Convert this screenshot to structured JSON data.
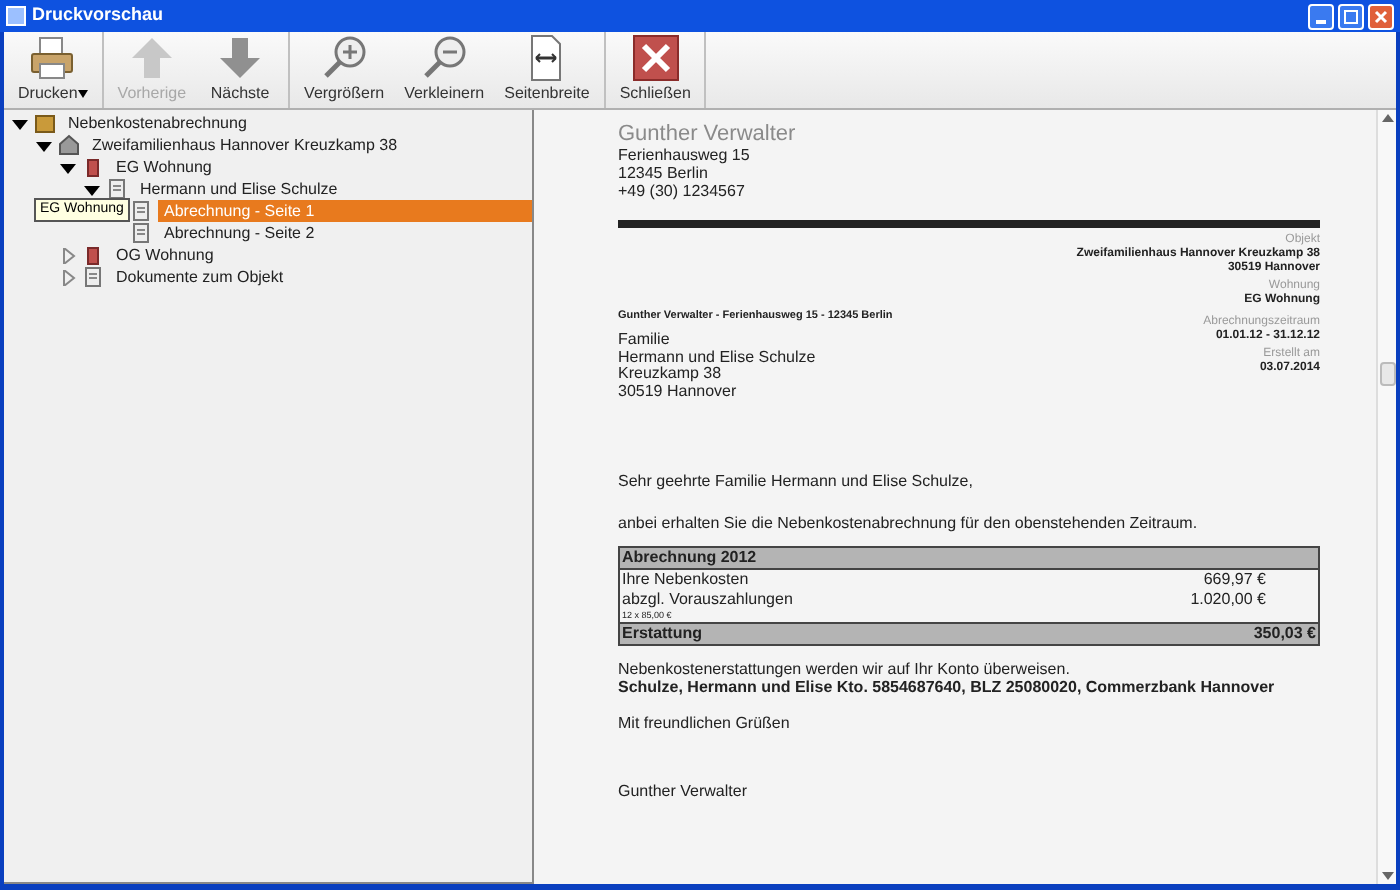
{
  "window": {
    "title": "Druckvorschau"
  },
  "toolbar": [
    [
      {
        "kind": "print",
        "label": "Drucken",
        "dropdown": true,
        "disabled": false
      }
    ],
    [
      {
        "kind": "prev",
        "label": "Vorherige",
        "dropdown": false,
        "disabled": true
      },
      {
        "kind": "next",
        "label": "Nächste",
        "dropdown": false,
        "disabled": false
      }
    ],
    [
      {
        "kind": "zoom_in",
        "label": "Vergrößern",
        "dropdown": false,
        "disabled": false
      },
      {
        "kind": "zoom_out",
        "label": "Verkleinern",
        "dropdown": false,
        "disabled": false
      },
      {
        "kind": "page_width",
        "label": "Seitenbreite",
        "dropdown": false,
        "disabled": false
      }
    ],
    [
      {
        "kind": "close",
        "label": "Schließen",
        "dropdown": false,
        "disabled": false
      }
    ]
  ],
  "tree": [
    {
      "kind": "root",
      "label": "Nebenkostenabrechnung",
      "expanded": true,
      "selected": false,
      "children": [
        {
          "kind": "house",
          "label": "Zweifamilienhaus Hannover Kreuzkamp 38",
          "expanded": true,
          "selected": false,
          "children": [
            {
              "kind": "apartment",
              "label": "EG Wohnung",
              "expanded": true,
              "selected": false,
              "children": [
                {
                  "kind": "tenant",
                  "label": "Hermann und Elise Schulze",
                  "expanded": true,
                  "selected": false,
                  "children": [
                    {
                      "kind": "page",
                      "label": "Abrechnung - Seite 1",
                      "selected": true
                    },
                    {
                      "kind": "page",
                      "label": "Abrechnung - Seite 2",
                      "selected": false
                    }
                  ]
                }
              ]
            },
            {
              "kind": "apartment",
              "label": "OG Wohnung",
              "expanded": false,
              "selected": false
            },
            {
              "kind": "docs",
              "label": "Dokumente zum Objekt",
              "expanded": false,
              "selected": false
            }
          ]
        }
      ]
    }
  ],
  "tooltip": {
    "text": "EG Wohnung"
  },
  "document": {
    "sender": {
      "name": "Gunther Verwalter",
      "street": "Ferienhausweg 15",
      "city": "12345 Berlin",
      "phone": "+49 (30) 1234567"
    },
    "meta_top": [
      {
        "label": "Objekt",
        "values": [
          "Zweifamilienhaus Hannover Kreuzkamp 38",
          "30519 Hannover"
        ]
      },
      {
        "label": "Wohnung",
        "values": [
          "EG Wohnung"
        ]
      }
    ],
    "return_address": "Gunther Verwalter - Ferienhausweg 15 - 12345 Berlin",
    "meta_side": [
      {
        "label": "Abrechnungszeitraum",
        "values": [
          "01.01.12 - 31.12.12"
        ]
      },
      {
        "label": "Erstellt am",
        "values": [
          "03.07.2014"
        ]
      }
    ],
    "recipient": [
      "Familie",
      "Hermann und Elise Schulze",
      "Kreuzkamp 38",
      "30519 Hannover"
    ],
    "salutation": "Sehr geehrte Familie Hermann und Elise Schulze,",
    "intro": "anbei erhalten Sie die Nebenkostenabrechnung für den obenstehenden Zeitraum.",
    "table": {
      "title": "Abrechnung 2012",
      "rows": [
        {
          "label": "Ihre Nebenkosten",
          "amount": "669,97 €"
        },
        {
          "label": "abzgl. Vorauszahlungen",
          "amount": "1.020,00 €",
          "note": "12 x 85,00 €"
        }
      ],
      "total": {
        "label": "Erstattung",
        "amount": "350,03 €"
      }
    },
    "refund_note": "Nebenkostenerstattungen werden wir auf Ihr Konto überweisen.",
    "bank_line": "Schulze, Hermann und Elise Kto. 5854687640, BLZ 25080020, Commerzbank Hannover",
    "closing": "Mit freundlichen Grüßen",
    "signature": "Gunther Verwalter"
  }
}
